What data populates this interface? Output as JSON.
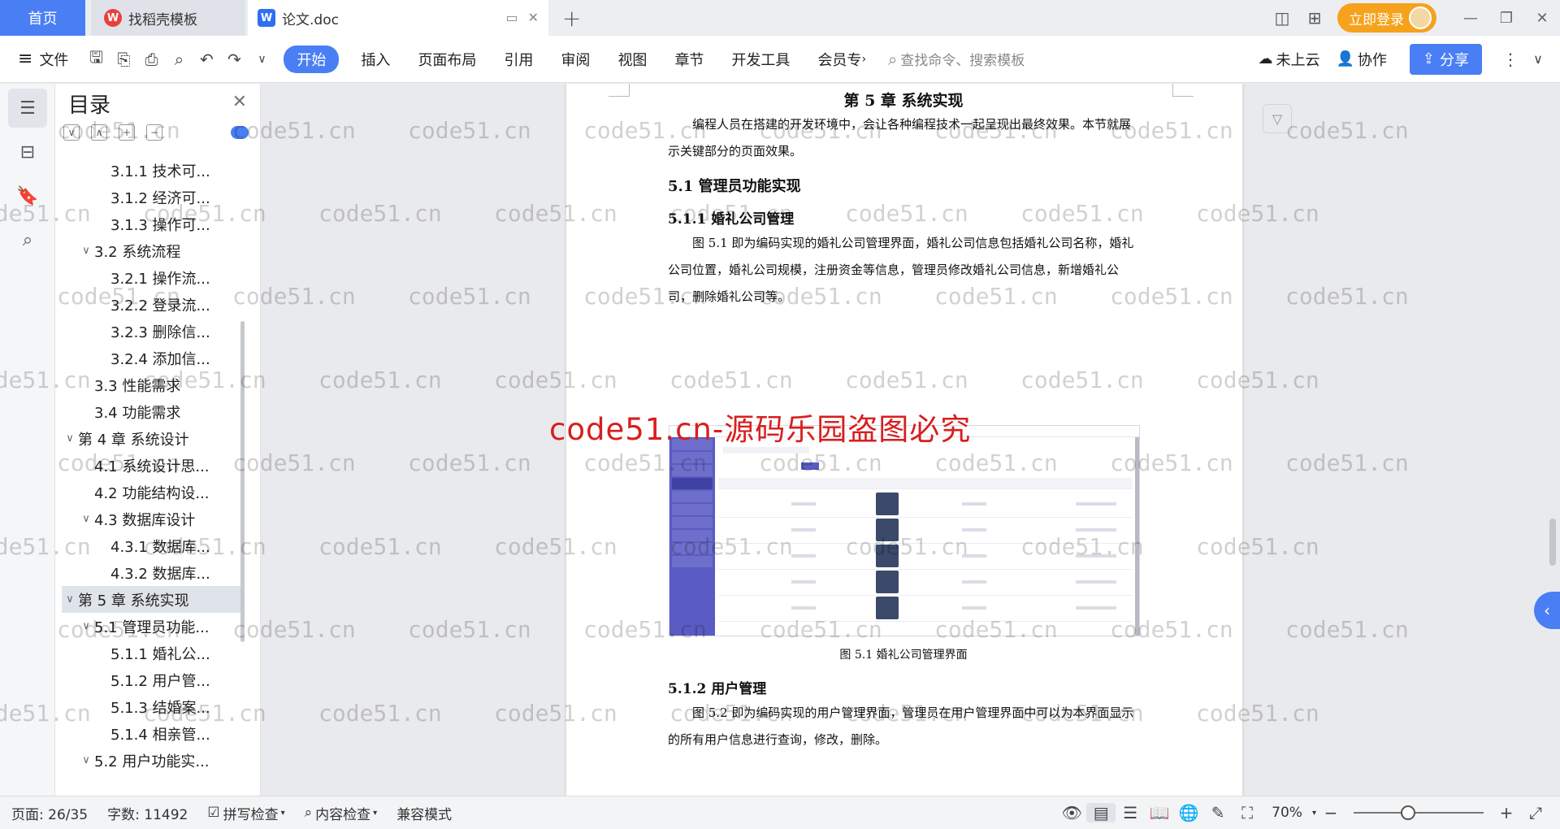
{
  "tabs": {
    "home": "首页",
    "template": "找稻壳模板",
    "doc": "论文.doc",
    "doc_icon": "W",
    "template_icon": "W"
  },
  "titlebar": {
    "login": "立即登录"
  },
  "ribbon": {
    "file": "文件",
    "items": [
      "开始",
      "插入",
      "页面布局",
      "引用",
      "审阅",
      "视图",
      "章节",
      "开发工具",
      "会员专"
    ],
    "search_placeholder": "查找命令、搜索模板",
    "cloud": "未上云",
    "collab": "协作",
    "share": "分享"
  },
  "nav": {
    "title": "目录",
    "items": [
      {
        "label": "3.1.1  技术可...",
        "level": 3,
        "arrow": ""
      },
      {
        "label": "3.1.2  经济可...",
        "level": 3,
        "arrow": ""
      },
      {
        "label": "3.1.3  操作可...",
        "level": 3,
        "arrow": ""
      },
      {
        "label": "3.2  系统流程",
        "level": 2,
        "arrow": "∨"
      },
      {
        "label": "3.2.1  操作流...",
        "level": 3,
        "arrow": ""
      },
      {
        "label": "3.2.2  登录流...",
        "level": 3,
        "arrow": ""
      },
      {
        "label": "3.2.3  删除信...",
        "level": 3,
        "arrow": ""
      },
      {
        "label": "3.2.4  添加信...",
        "level": 3,
        "arrow": ""
      },
      {
        "label": "3.3  性能需求",
        "level": 2,
        "arrow": ""
      },
      {
        "label": "3.4  功能需求",
        "level": 2,
        "arrow": ""
      },
      {
        "label": "第 4 章  系统设计",
        "level": 1,
        "arrow": "∨"
      },
      {
        "label": "4.1  系统设计思...",
        "level": 2,
        "arrow": ""
      },
      {
        "label": "4.2  功能结构设...",
        "level": 2,
        "arrow": ""
      },
      {
        "label": "4.3  数据库设计",
        "level": 2,
        "arrow": "∨"
      },
      {
        "label": "4.3.1  数据库...",
        "level": 3,
        "arrow": ""
      },
      {
        "label": "4.3.2  数据库...",
        "level": 3,
        "arrow": ""
      },
      {
        "label": "第 5 章  系统实现",
        "level": 1,
        "arrow": "∨",
        "selected": true
      },
      {
        "label": "5.1  管理员功能...",
        "level": 2,
        "arrow": "∨"
      },
      {
        "label": "5.1.1  婚礼公...",
        "level": 3,
        "arrow": ""
      },
      {
        "label": "5.1.2  用户管...",
        "level": 3,
        "arrow": ""
      },
      {
        "label": "5.1.3  结婚案...",
        "level": 3,
        "arrow": ""
      },
      {
        "label": "5.1.4  相亲管...",
        "level": 3,
        "arrow": ""
      },
      {
        "label": "5.2  用户功能实...",
        "level": 2,
        "arrow": "∨"
      }
    ]
  },
  "doc": {
    "chapter": "第 5 章  系统实现",
    "intro": "编程人员在搭建的开发环境中，会让各种编程技术一起呈现出最终效果。本节就展示关键部分的页面效果。",
    "s51": "5.1  管理员功能实现",
    "s511": "5.1.1  婚礼公司管理",
    "p511": "图 5.1 即为编码实现的婚礼公司管理界面，婚礼公司信息包括婚礼公司名称，婚礼公司位置，婚礼公司规模，注册资金等信息，管理员修改婚礼公司信息，新增婚礼公司，删除婚礼公司等。",
    "fig_caption": "图 5.1  婚礼公司管理界面",
    "s512": "5.1.2  用户管理",
    "p512": "图 5.2 即为编码实现的用户管理界面，管理员在用户管理界面中可以为本界面显示的所有用户信息进行查询，修改，删除。"
  },
  "watermark": {
    "text": "code51.cn",
    "red_text": "code51.cn-源码乐园盗图必究"
  },
  "status": {
    "page": "页面: 26/35",
    "words": "字数: 11492",
    "spell": "拼写检查",
    "content": "内容检查",
    "compat": "兼容模式",
    "zoom": "70%"
  },
  "colors": {
    "accent": "#4a7ef5",
    "login": "#f6a21c",
    "watermark_red": "#d81e1e",
    "figure_sidebar": "#5a5cc4"
  }
}
